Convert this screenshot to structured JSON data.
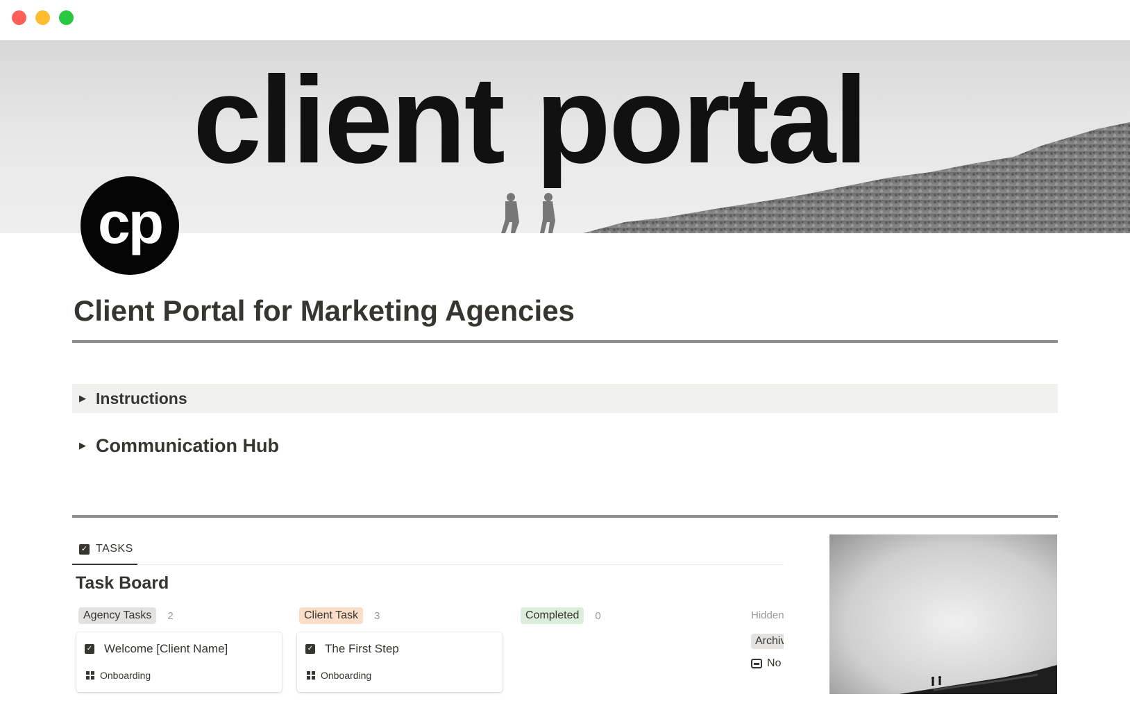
{
  "window": {
    "controls": [
      "close",
      "minimize",
      "zoom"
    ]
  },
  "cover": {
    "title": "client portal"
  },
  "page": {
    "icon_text": "cp",
    "title": "Client Portal for Marketing Agencies"
  },
  "toggles": [
    {
      "label": "Instructions"
    },
    {
      "label": "Communication Hub"
    }
  ],
  "tasks": {
    "tab_label": "TASKS",
    "board_title": "Task Board",
    "groups": [
      {
        "label": "Agency Tasks",
        "count": "2",
        "color": "#e3e2e0"
      },
      {
        "label": "Client Task",
        "count": "3",
        "color": "#fadec9"
      },
      {
        "label": "Completed",
        "count": "0",
        "color": "#dbeddb"
      }
    ],
    "hidden": {
      "label": "Hidden",
      "archive_label": "Archive",
      "no_status_label": "No"
    },
    "cards": [
      {
        "title": "Welcome [Client Name]",
        "tag": "Onboarding"
      },
      {
        "title": "The First Step",
        "tag": "Onboarding"
      }
    ]
  },
  "icons": {
    "toggle": "triangle-right-icon",
    "task": "checkbox-icon",
    "tag": "grid-icon",
    "inbox": "inbox-icon"
  }
}
